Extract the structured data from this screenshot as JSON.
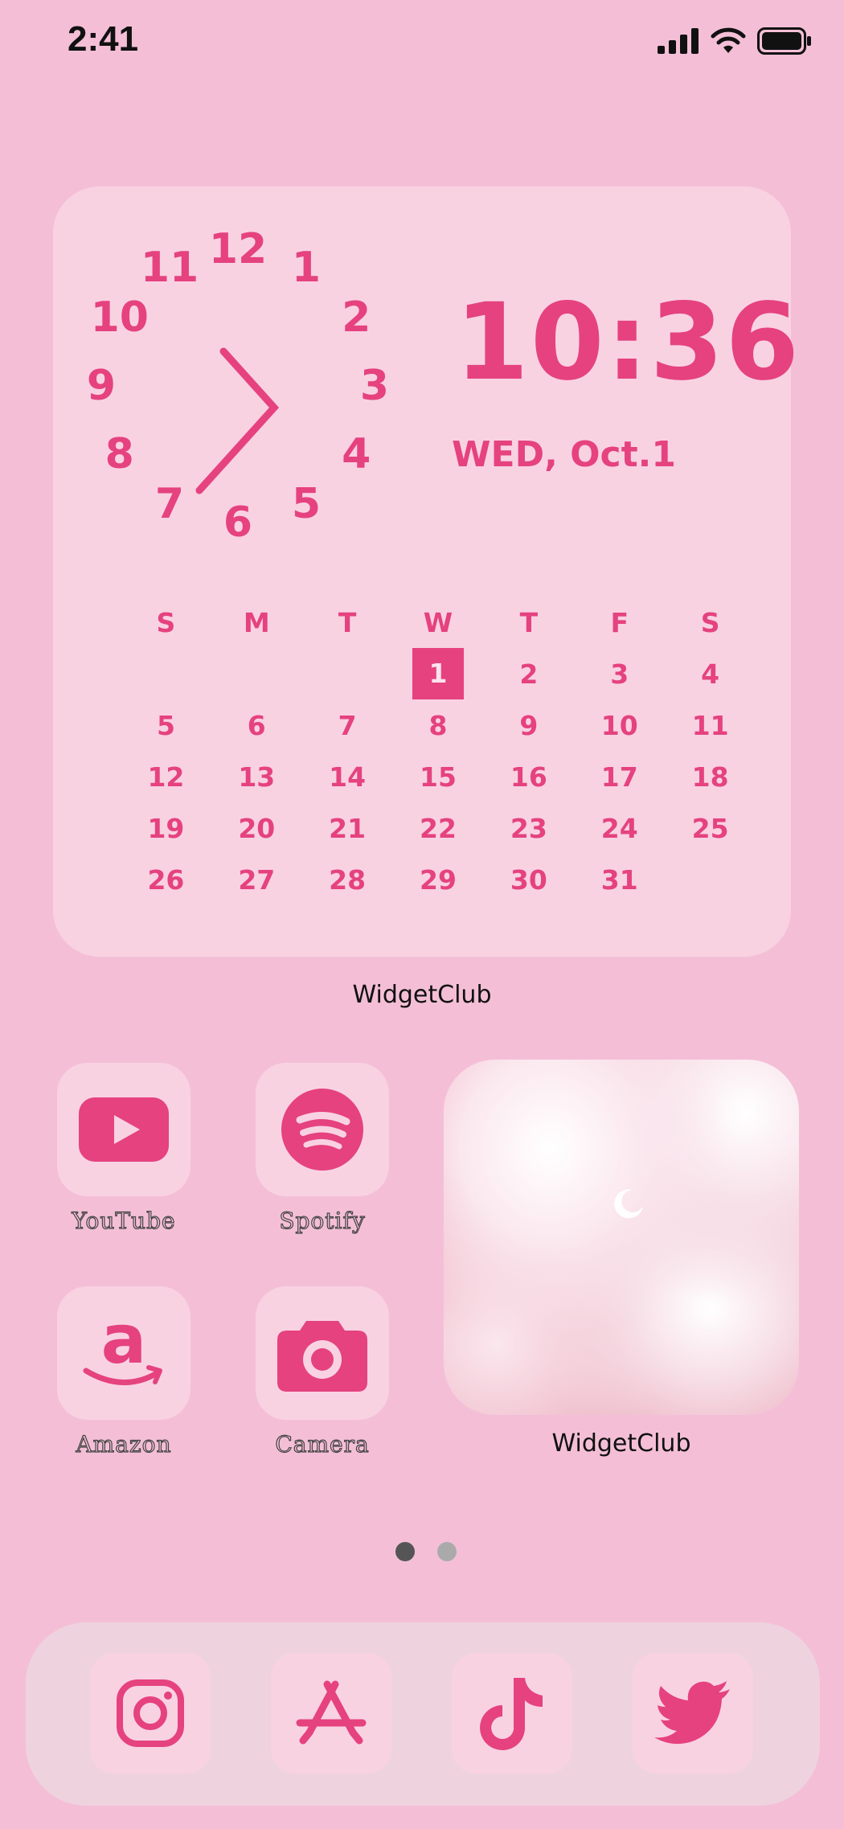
{
  "status_bar": {
    "time": "2:41"
  },
  "clock_widget": {
    "clock_numbers": [
      "12",
      "1",
      "2",
      "3",
      "4",
      "5",
      "6",
      "7",
      "8",
      "9",
      "10",
      "11"
    ],
    "time": "10:36",
    "date": "WED, Oct.1",
    "weekdays": [
      "S",
      "M",
      "T",
      "W",
      "T",
      "F",
      "S"
    ],
    "weeks": [
      [
        "",
        "",
        "",
        "1",
        "2",
        "3",
        "4"
      ],
      [
        "5",
        "6",
        "7",
        "8",
        "9",
        "10",
        "11"
      ],
      [
        "12",
        "13",
        "14",
        "15",
        "16",
        "17",
        "18"
      ],
      [
        "19",
        "20",
        "21",
        "22",
        "23",
        "24",
        "25"
      ],
      [
        "26",
        "27",
        "28",
        "29",
        "30",
        "31",
        ""
      ]
    ],
    "today": "1",
    "caption": "WidgetClub"
  },
  "apps": [
    {
      "label": "YouTube",
      "icon": "youtube-icon"
    },
    {
      "label": "Spotify",
      "icon": "spotify-icon"
    },
    {
      "label": "Amazon",
      "icon": "amazon-icon"
    },
    {
      "label": "Camera",
      "icon": "camera-icon"
    }
  ],
  "photo_widget": {
    "caption": "WidgetClub"
  },
  "page_indicator": {
    "current": 1,
    "total": 2
  },
  "dock": [
    {
      "icon": "instagram-icon"
    },
    {
      "icon": "app-store-icon"
    },
    {
      "icon": "tiktok-icon"
    },
    {
      "icon": "twitter-icon"
    }
  ],
  "colors": {
    "accent": "#e5427f",
    "background": "#f4bfd6",
    "tile": "#f9d2e2"
  }
}
